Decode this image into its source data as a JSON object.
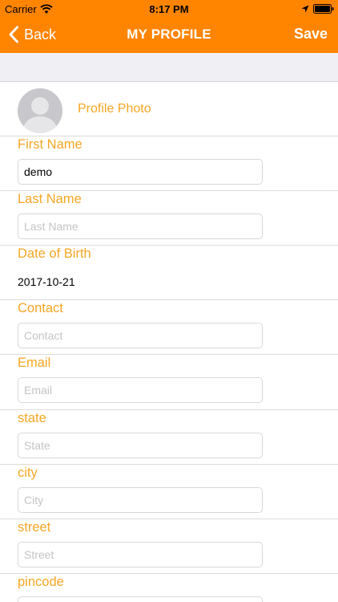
{
  "status_bar": {
    "carrier": "Carrier",
    "time": "8:17 PM"
  },
  "nav": {
    "back_label": "Back",
    "title": "MY PROFILE",
    "save_label": "Save"
  },
  "colors": {
    "accent": "#ff8400",
    "label": "#f5a623"
  },
  "profile_photo": {
    "label": "Profile Photo"
  },
  "fields": {
    "first_name": {
      "label": "First Name",
      "value": "demo",
      "placeholder": ""
    },
    "last_name": {
      "label": "Last Name",
      "value": "",
      "placeholder": "Last Name"
    },
    "dob": {
      "label": "Date of Birth",
      "value": "2017-10-21"
    },
    "contact": {
      "label": "Contact",
      "value": "",
      "placeholder": "Contact"
    },
    "email": {
      "label": "Email",
      "value": "",
      "placeholder": "Email"
    },
    "state": {
      "label": "state",
      "value": "",
      "placeholder": "State"
    },
    "city": {
      "label": "city",
      "value": "",
      "placeholder": "City"
    },
    "street": {
      "label": "street",
      "value": "",
      "placeholder": "Street"
    },
    "pincode": {
      "label": "pincode",
      "value": "",
      "placeholder": ""
    }
  },
  "icons": [
    "wifi-icon",
    "location-arrow-icon",
    "battery-icon",
    "chevron-left-icon",
    "avatar-placeholder-icon"
  ]
}
